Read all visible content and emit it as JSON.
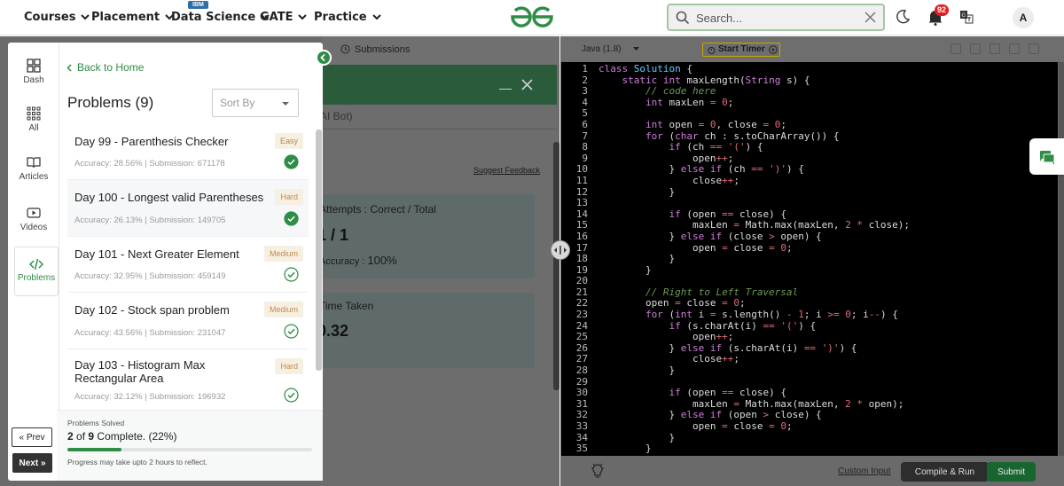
{
  "nav": {
    "items": [
      {
        "label": "Courses"
      },
      {
        "label": "Placement"
      },
      {
        "label": "Data Science",
        "badge": "IBM"
      },
      {
        "label": "GATE"
      },
      {
        "label": "Practice"
      }
    ],
    "search_placeholder": "Search...",
    "notification_count": "92",
    "avatar_letter": "A",
    "brand_color": "#2f8d46"
  },
  "submissions_tab": "Submissions",
  "modal": {
    "tab_text": "AI Bot)",
    "suggest": "Suggest Feedback",
    "attempts_label": "Attempts : Correct / Total",
    "attempts_value": "1 / 1",
    "accuracy_label": "Accuracy :",
    "accuracy_value": "100%",
    "time_label": "Time Taken",
    "time_value": "0.32"
  },
  "sidebar": {
    "rail": [
      {
        "label": "Dash",
        "icon": "dashboard-icon"
      },
      {
        "label": "All",
        "icon": "grid-icon"
      },
      {
        "label": "Articles",
        "icon": "book-icon"
      },
      {
        "label": "Videos",
        "icon": "video-icon"
      },
      {
        "label": "Problems",
        "icon": "code-icon",
        "active": true
      }
    ],
    "prev": "Prev",
    "next": "Next",
    "back": "Back to Home",
    "title": "Problems (9)",
    "sort_placeholder": "Sort By"
  },
  "problems": [
    {
      "name": "Day 99 - Parenthesis Checker",
      "difficulty": "Easy",
      "meta": "Accuracy: 28.56% | Submission: 671178",
      "solved": true
    },
    {
      "name": "Day 100 - Longest valid Parentheses",
      "difficulty": "Hard",
      "meta": "Accuracy: 26.13% | Submission: 149705",
      "solved": true
    },
    {
      "name": "Day 101 - Next Greater Element",
      "difficulty": "Medium",
      "meta": "Accuracy: 32.95% | Submission: 459149",
      "solved": false
    },
    {
      "name": "Day 102 - Stock span problem",
      "difficulty": "Medium",
      "meta": "Accuracy: 43.56% | Submission: 231047",
      "solved": false
    },
    {
      "name": "Day 103 - Histogram Max Rectangular Area",
      "difficulty": "Hard",
      "meta": "Accuracy: 32.12% | Submission: 196932",
      "solved": false
    }
  ],
  "progress": {
    "label": "Problems Solved",
    "solved": "2",
    "of_word": "of",
    "total": "9",
    "suffix": "Complete. (22%)",
    "fraction": 0.22,
    "note": "Progress may take upto 2 hours to reflect."
  },
  "editor": {
    "language": "Java (1.8)",
    "timer": "Start Timer",
    "custom_input": "Custom Input",
    "compile": "Compile & Run",
    "submit": "Submit",
    "code": [
      "class Solution {",
      "    static int maxLength(String s) {",
      "        // code here",
      "        int maxLen = 0;",
      "",
      "        int open = 0, close = 0;",
      "        for (char ch : s.toCharArray()) {",
      "            if (ch == '(') {",
      "                open++;",
      "            } else if (ch == ')') {",
      "                close++;",
      "            }",
      "",
      "            if (open == close) {",
      "                maxLen = Math.max(maxLen, 2 * close);",
      "            } else if (close > open) {",
      "                open = close = 0;",
      "            }",
      "        }",
      "",
      "        // Right to Left Traversal",
      "        open = close = 0;",
      "        for (int i = s.length() - 1; i >= 0; i--) {",
      "            if (s.charAt(i) == '(') {",
      "                open++;",
      "            } else if (s.charAt(i) == ')') {",
      "                close++;",
      "            }",
      "",
      "            if (open == close) {",
      "                maxLen = Math.max(maxLen, 2 * open);",
      "            } else if (open > close) {",
      "                open = close = 0;",
      "            }",
      "        }"
    ]
  }
}
